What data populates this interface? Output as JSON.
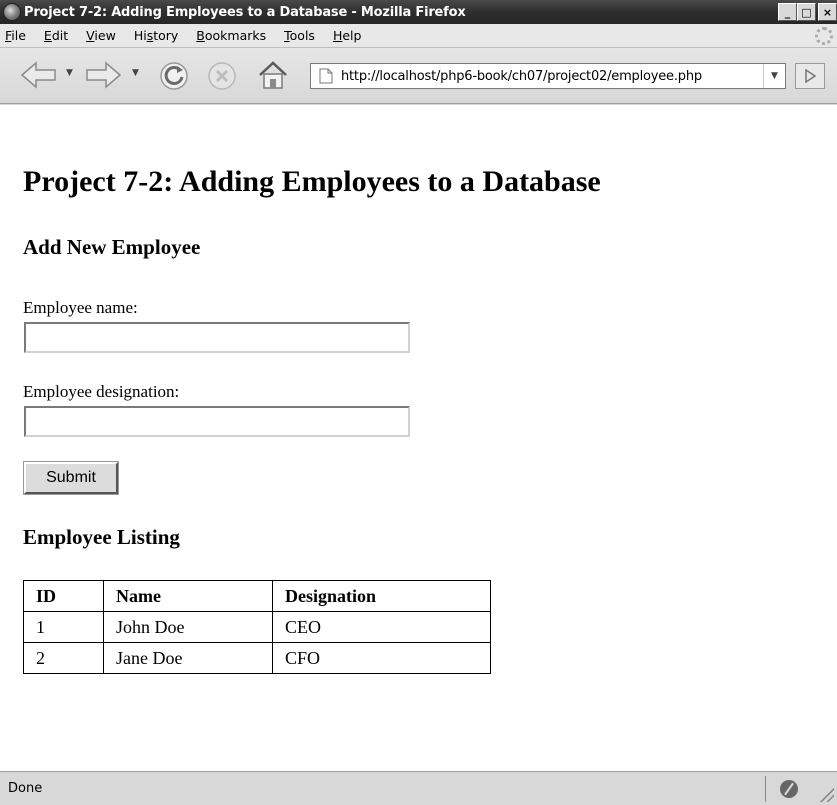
{
  "window": {
    "title": "Project 7-2: Adding Employees to a Database - Mozilla Firefox",
    "controls": {
      "minimize": "_",
      "maximize": "□",
      "close": "×"
    }
  },
  "menubar": {
    "items": [
      {
        "accel": "F",
        "rest": "ile"
      },
      {
        "accel": "E",
        "rest": "dit"
      },
      {
        "accel": "V",
        "rest": "iew"
      },
      {
        "pre": "Hi",
        "accel": "s",
        "rest": "tory"
      },
      {
        "accel": "B",
        "rest": "ookmarks"
      },
      {
        "accel": "T",
        "rest": "ools"
      },
      {
        "accel": "H",
        "rest": "elp"
      }
    ]
  },
  "navbar": {
    "url": "http://localhost/php6-book/ch07/project02/employee.php",
    "icons": [
      "back-icon",
      "forward-icon",
      "reload-icon",
      "stop-icon",
      "home-icon",
      "page-icon",
      "go-icon"
    ]
  },
  "page": {
    "title": "Project 7-2: Adding Employees to a Database",
    "form": {
      "heading": "Add New Employee",
      "name_label": "Employee name:",
      "name_value": "",
      "designation_label": "Employee designation:",
      "designation_value": "",
      "submit_label": "Submit"
    },
    "listing": {
      "heading": "Employee Listing",
      "columns": [
        "ID",
        "Name",
        "Designation"
      ],
      "rows": [
        [
          "1",
          "John Doe",
          "CEO"
        ],
        [
          "2",
          "Jane Doe",
          "CFO"
        ]
      ]
    }
  },
  "status": {
    "text": "Done"
  },
  "colors": {
    "titlebar": "#2e2e2e",
    "chrome": "#d8d8d8",
    "content_bg": "#ffffff"
  }
}
